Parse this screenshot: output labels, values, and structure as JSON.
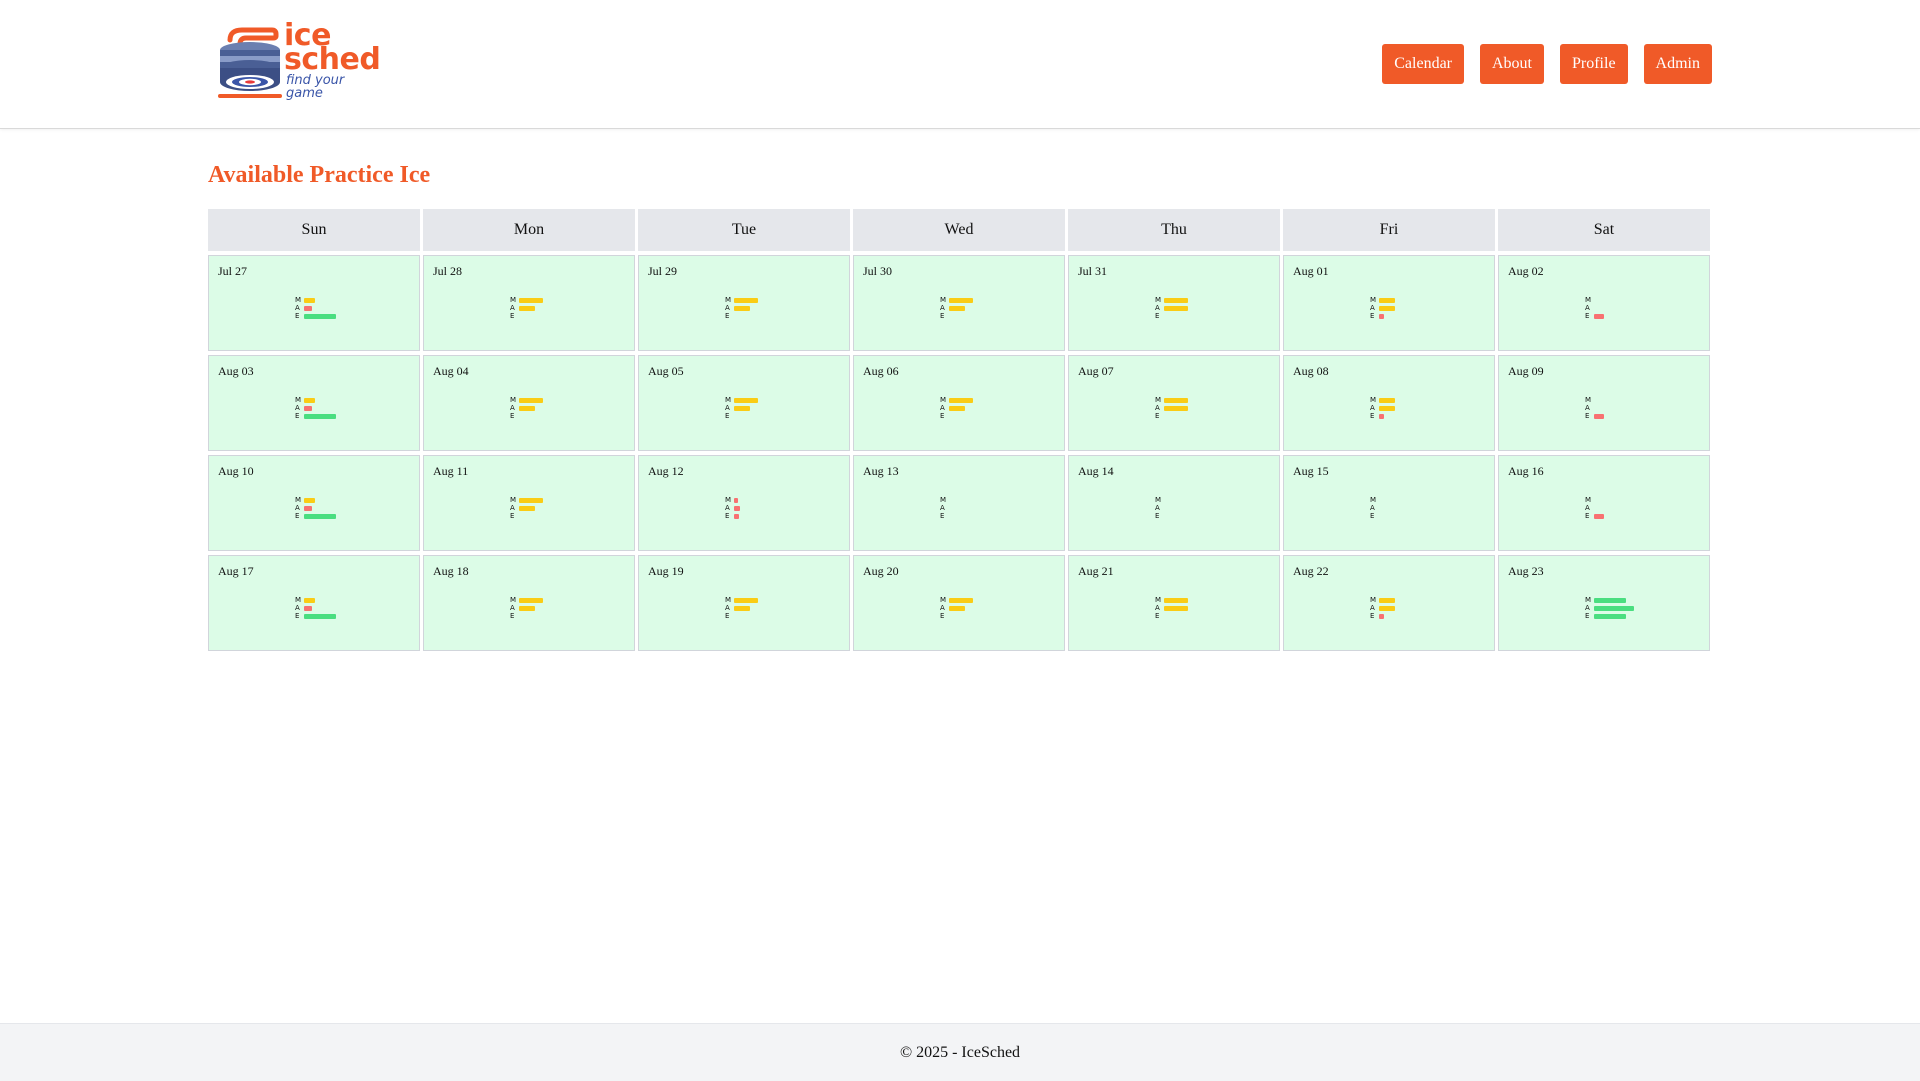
{
  "brand": {
    "line1": "ice",
    "line2": "sched",
    "tagline": "find your game"
  },
  "nav": {
    "calendar": "Calendar",
    "about": "About",
    "profile": "Profile",
    "admin": "Admin"
  },
  "page": {
    "title": "Available Practice Ice"
  },
  "colors": {
    "accent": "#f05a28",
    "day_bg": "#dcfce7",
    "header_bg": "#e5e7eb",
    "low": "#f87171",
    "mid": "#facc15",
    "high": "#4ade80"
  },
  "calendar": {
    "weekdays": [
      "Sun",
      "Mon",
      "Tue",
      "Wed",
      "Thu",
      "Fri",
      "Sat"
    ],
    "slot_labels": [
      "M",
      "A",
      "E"
    ],
    "note": "availability shown as bar fill fraction per slot (Morning / Afternoon / Evening), level = color band",
    "days": [
      {
        "date": "Jul 27",
        "slots": [
          {
            "fill": 0.35,
            "level": "mid"
          },
          {
            "fill": 0.25,
            "level": "low"
          },
          {
            "fill": 1.0,
            "level": "high"
          }
        ]
      },
      {
        "date": "Jul 28",
        "slots": [
          {
            "fill": 0.75,
            "level": "mid"
          },
          {
            "fill": 0.5,
            "level": "mid"
          },
          {
            "fill": 0,
            "level": "none"
          }
        ]
      },
      {
        "date": "Jul 29",
        "slots": [
          {
            "fill": 0.75,
            "level": "mid"
          },
          {
            "fill": 0.5,
            "level": "mid"
          },
          {
            "fill": 0,
            "level": "none"
          }
        ]
      },
      {
        "date": "Jul 30",
        "slots": [
          {
            "fill": 0.75,
            "level": "mid"
          },
          {
            "fill": 0.5,
            "level": "mid"
          },
          {
            "fill": 0,
            "level": "none"
          }
        ]
      },
      {
        "date": "Jul 31",
        "slots": [
          {
            "fill": 0.75,
            "level": "mid"
          },
          {
            "fill": 0.75,
            "level": "mid"
          },
          {
            "fill": 0,
            "level": "none"
          }
        ]
      },
      {
        "date": "Aug 01",
        "slots": [
          {
            "fill": 0.5,
            "level": "mid"
          },
          {
            "fill": 0.5,
            "level": "mid"
          },
          {
            "fill": 0.15,
            "level": "low"
          }
        ]
      },
      {
        "date": "Aug 02",
        "slots": [
          {
            "fill": 0,
            "level": "none"
          },
          {
            "fill": 0,
            "level": "none"
          },
          {
            "fill": 0.3,
            "level": "low"
          }
        ]
      },
      {
        "date": "Aug 03",
        "slots": [
          {
            "fill": 0.35,
            "level": "mid"
          },
          {
            "fill": 0.25,
            "level": "low"
          },
          {
            "fill": 1.0,
            "level": "high"
          }
        ]
      },
      {
        "date": "Aug 04",
        "slots": [
          {
            "fill": 0.75,
            "level": "mid"
          },
          {
            "fill": 0.5,
            "level": "mid"
          },
          {
            "fill": 0,
            "level": "none"
          }
        ]
      },
      {
        "date": "Aug 05",
        "slots": [
          {
            "fill": 0.75,
            "level": "mid"
          },
          {
            "fill": 0.5,
            "level": "mid"
          },
          {
            "fill": 0,
            "level": "none"
          }
        ]
      },
      {
        "date": "Aug 06",
        "slots": [
          {
            "fill": 0.75,
            "level": "mid"
          },
          {
            "fill": 0.5,
            "level": "mid"
          },
          {
            "fill": 0,
            "level": "none"
          }
        ]
      },
      {
        "date": "Aug 07",
        "slots": [
          {
            "fill": 0.75,
            "level": "mid"
          },
          {
            "fill": 0.75,
            "level": "mid"
          },
          {
            "fill": 0,
            "level": "none"
          }
        ]
      },
      {
        "date": "Aug 08",
        "slots": [
          {
            "fill": 0.5,
            "level": "mid"
          },
          {
            "fill": 0.5,
            "level": "mid"
          },
          {
            "fill": 0.15,
            "level": "low"
          }
        ]
      },
      {
        "date": "Aug 09",
        "slots": [
          {
            "fill": 0,
            "level": "none"
          },
          {
            "fill": 0,
            "level": "none"
          },
          {
            "fill": 0.3,
            "level": "low"
          }
        ]
      },
      {
        "date": "Aug 10",
        "slots": [
          {
            "fill": 0.35,
            "level": "mid"
          },
          {
            "fill": 0.25,
            "level": "low"
          },
          {
            "fill": 1.0,
            "level": "high"
          }
        ]
      },
      {
        "date": "Aug 11",
        "slots": [
          {
            "fill": 0.75,
            "level": "mid"
          },
          {
            "fill": 0.5,
            "level": "mid"
          },
          {
            "fill": 0,
            "level": "none"
          }
        ]
      },
      {
        "date": "Aug 12",
        "slots": [
          {
            "fill": 0.12,
            "level": "low"
          },
          {
            "fill": 0.2,
            "level": "low"
          },
          {
            "fill": 0.15,
            "level": "low"
          }
        ]
      },
      {
        "date": "Aug 13",
        "slots": [
          {
            "fill": 0,
            "level": "none"
          },
          {
            "fill": 0,
            "level": "none"
          },
          {
            "fill": 0,
            "level": "none"
          }
        ]
      },
      {
        "date": "Aug 14",
        "slots": [
          {
            "fill": 0,
            "level": "none"
          },
          {
            "fill": 0,
            "level": "none"
          },
          {
            "fill": 0,
            "level": "none"
          }
        ]
      },
      {
        "date": "Aug 15",
        "slots": [
          {
            "fill": 0,
            "level": "none"
          },
          {
            "fill": 0,
            "level": "none"
          },
          {
            "fill": 0,
            "level": "none"
          }
        ]
      },
      {
        "date": "Aug 16",
        "slots": [
          {
            "fill": 0,
            "level": "none"
          },
          {
            "fill": 0,
            "level": "none"
          },
          {
            "fill": 0.3,
            "level": "low"
          }
        ]
      },
      {
        "date": "Aug 17",
        "slots": [
          {
            "fill": 0.35,
            "level": "mid"
          },
          {
            "fill": 0.25,
            "level": "low"
          },
          {
            "fill": 1.0,
            "level": "high"
          }
        ]
      },
      {
        "date": "Aug 18",
        "slots": [
          {
            "fill": 0.75,
            "level": "mid"
          },
          {
            "fill": 0.5,
            "level": "mid"
          },
          {
            "fill": 0,
            "level": "none"
          }
        ]
      },
      {
        "date": "Aug 19",
        "slots": [
          {
            "fill": 0.75,
            "level": "mid"
          },
          {
            "fill": 0.5,
            "level": "mid"
          },
          {
            "fill": 0,
            "level": "none"
          }
        ]
      },
      {
        "date": "Aug 20",
        "slots": [
          {
            "fill": 0.75,
            "level": "mid"
          },
          {
            "fill": 0.5,
            "level": "mid"
          },
          {
            "fill": 0,
            "level": "none"
          }
        ]
      },
      {
        "date": "Aug 21",
        "slots": [
          {
            "fill": 0.75,
            "level": "mid"
          },
          {
            "fill": 0.75,
            "level": "mid"
          },
          {
            "fill": 0,
            "level": "none"
          }
        ]
      },
      {
        "date": "Aug 22",
        "slots": [
          {
            "fill": 0.5,
            "level": "mid"
          },
          {
            "fill": 0.5,
            "level": "mid"
          },
          {
            "fill": 0.15,
            "level": "low"
          }
        ]
      },
      {
        "date": "Aug 23",
        "slots": [
          {
            "fill": 1.0,
            "level": "high"
          },
          {
            "fill": 1.25,
            "level": "high"
          },
          {
            "fill": 1.0,
            "level": "high"
          }
        ]
      }
    ]
  },
  "footer": {
    "text": "© 2025 - IceSched"
  }
}
